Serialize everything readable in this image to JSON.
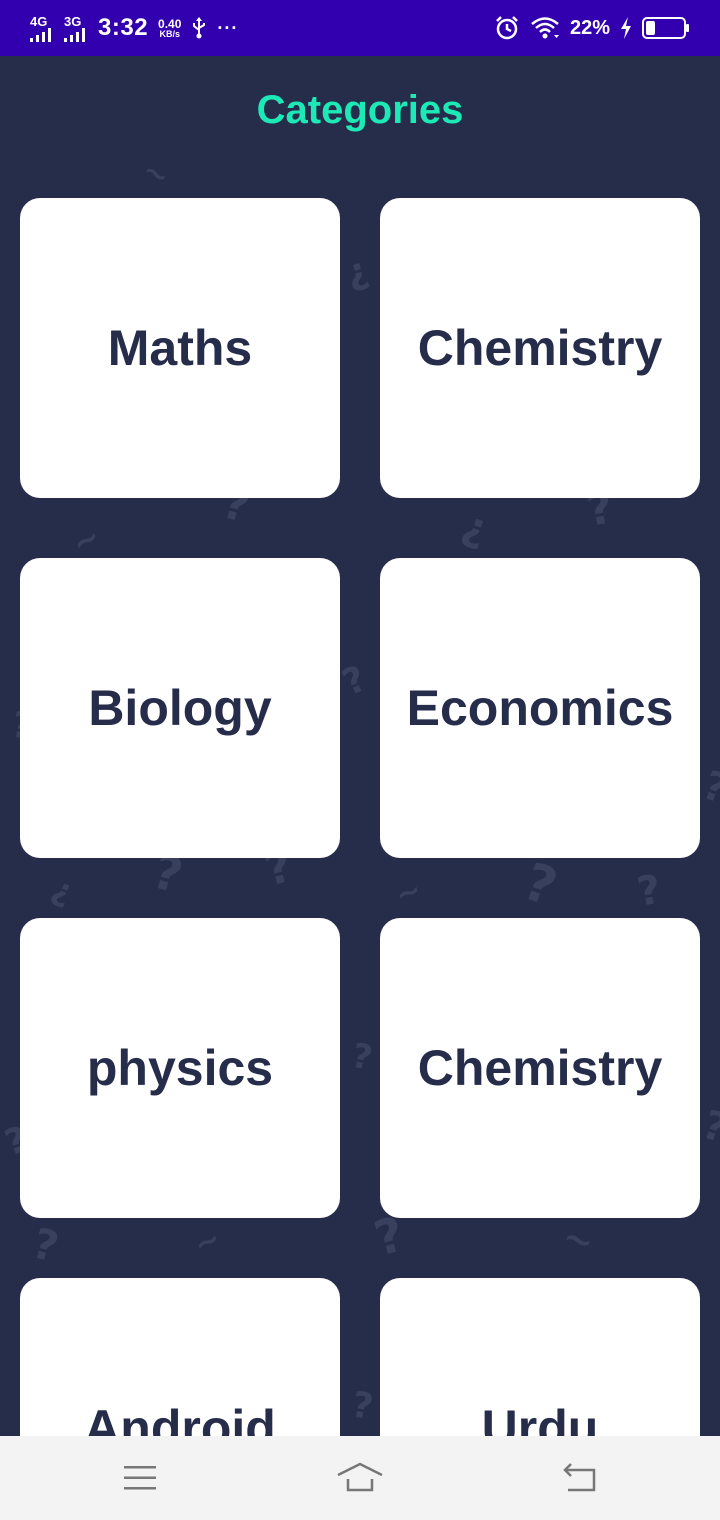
{
  "status_bar": {
    "network_1": "4G",
    "network_2": "3G",
    "time": "3:32",
    "speed_value": "0.40",
    "speed_unit": "KB/s",
    "more": "···",
    "battery_percent": "22%"
  },
  "title": "Categories",
  "categories": [
    {
      "label": "Maths"
    },
    {
      "label": "Chemistry"
    },
    {
      "label": "Biology"
    },
    {
      "label": "Economics"
    },
    {
      "label": "physics"
    },
    {
      "label": "Chemistry"
    },
    {
      "label": "Android"
    },
    {
      "label": "Urdu"
    }
  ],
  "colors": {
    "status_bar": "#3300b0",
    "background": "#262d4a",
    "title": "#1de9b6",
    "card": "#ffffff",
    "card_text": "#262d4a"
  },
  "icons": {
    "status": [
      "signal-icon",
      "usb-icon",
      "alarm-icon",
      "wifi-icon",
      "charging-icon",
      "battery-icon"
    ],
    "nav": [
      "menu-icon",
      "home-icon",
      "back-icon"
    ]
  }
}
